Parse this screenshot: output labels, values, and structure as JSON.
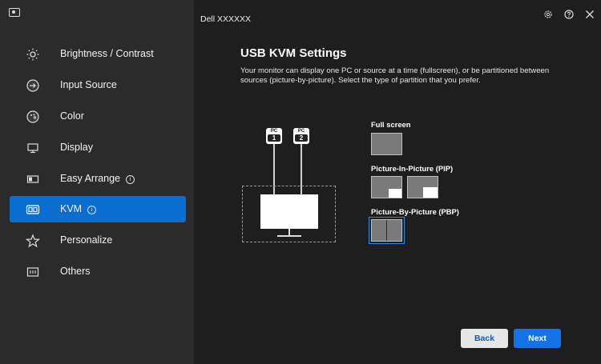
{
  "window": {
    "title": "Dell XXXXXX"
  },
  "sidebar": {
    "items": [
      {
        "label": "Brightness / Contrast",
        "icon": "sun-icon",
        "info": false,
        "active": false
      },
      {
        "label": "Input Source",
        "icon": "input-source-icon",
        "info": false,
        "active": false
      },
      {
        "label": "Color",
        "icon": "palette-icon",
        "info": false,
        "active": false
      },
      {
        "label": "Display",
        "icon": "monitor-icon",
        "info": false,
        "active": false
      },
      {
        "label": "Easy Arrange",
        "icon": "easy-arrange-icon",
        "info": true,
        "active": false
      },
      {
        "label": "KVM",
        "icon": "kvm-icon",
        "info": true,
        "active": true
      },
      {
        "label": "Personalize",
        "icon": "star-icon",
        "info": false,
        "active": false
      },
      {
        "label": "Others",
        "icon": "others-icon",
        "info": false,
        "active": false
      }
    ]
  },
  "page": {
    "heading": "USB KVM Settings",
    "description": "Your monitor can display one PC or source at a time (fullscreen), or be partitioned between sources (picture-by-picture). Select the type of partition that you prefer."
  },
  "diagram": {
    "pc1": {
      "label": "PC",
      "number": "1"
    },
    "pc2": {
      "label": "PC",
      "number": "2"
    }
  },
  "options": {
    "full_screen": "Full screen",
    "pip": "Picture-In-Picture (PIP)",
    "pbp": "Picture-By-Picture (PBP)",
    "selected": "pbp"
  },
  "buttons": {
    "back": "Back",
    "next": "Next"
  },
  "colors": {
    "accent": "#0a6ed1",
    "next_button": "#1473e6",
    "selection_outline": "#2d88e8"
  }
}
